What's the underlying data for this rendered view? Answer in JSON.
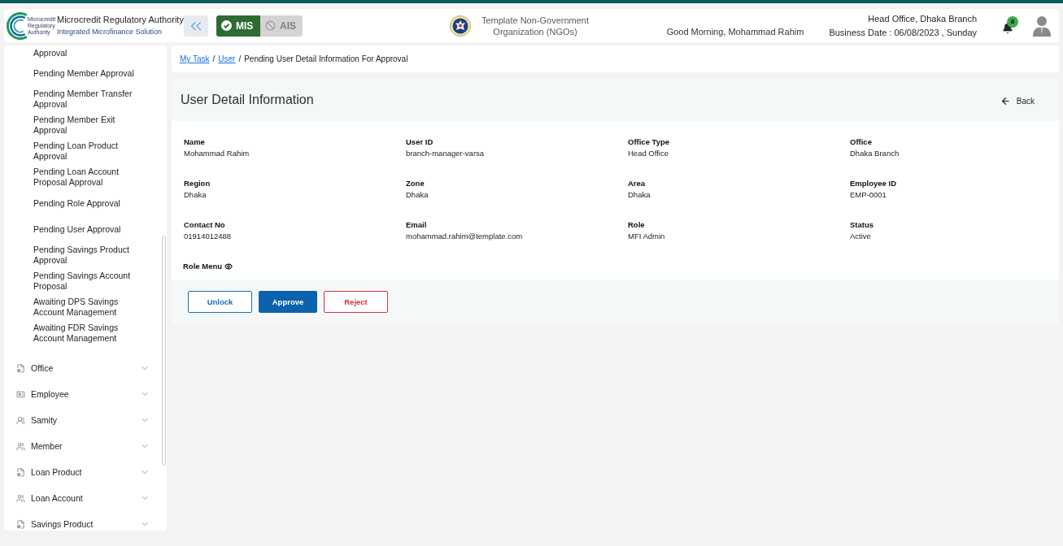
{
  "header": {
    "logo_text": "Microcredit Regulatory Authority",
    "title": "Microcredit Regulatory Authority",
    "subtitle": "Integrated Microfinance Solution",
    "modules": [
      {
        "label": "MIS",
        "selected": true
      },
      {
        "label": "AIS",
        "selected": false
      }
    ],
    "organization": "Template Non-Government Organization (NGOs)",
    "greeting": "Good Morning, Mohammad Rahim",
    "office": "Head Office, Dhaka Branch",
    "business_date": "Business Date : 06/08/2023 , Sunday",
    "notification_count": "8"
  },
  "sidebar": {
    "task_items": [
      "Approval",
      "Pending Member Approval",
      "Pending Member Transfer Approval",
      "Pending Member Exit Approval",
      "Pending Loan Product Approval",
      "Pending Loan Account Proposal Approval",
      "Pending Role Approval",
      "Pending User Approval",
      "Pending Savings Product Approval",
      "Pending Savings Account Proposal",
      "Awaiting DPS Savings Account Management",
      "Awaiting FDR Savings Account Management"
    ],
    "groups": [
      {
        "label": "Office",
        "kind": "document",
        "expanded": false
      },
      {
        "label": "Employee",
        "kind": "idcard",
        "expanded": false
      },
      {
        "label": "Samity",
        "kind": "team",
        "expanded": false
      },
      {
        "label": "Member",
        "kind": "people",
        "expanded": false
      },
      {
        "label": "Loan Product",
        "kind": "document",
        "expanded": false
      },
      {
        "label": "Loan Account",
        "kind": "people",
        "expanded": false
      },
      {
        "label": "Savings Product",
        "kind": "document",
        "expanded": false
      }
    ]
  },
  "breadcrumb": [
    {
      "kind": "link",
      "label": "My Task"
    },
    {
      "kind": "separator",
      "label": "/"
    },
    {
      "kind": "link",
      "label": "User"
    },
    {
      "kind": "separator",
      "label": "/"
    },
    {
      "kind": "current",
      "label": "Pending User Detail Information For Approval"
    }
  ],
  "detail": {
    "title": "User Detail Information",
    "back": "Back",
    "fields": [
      {
        "label": "Name",
        "value": "Mohammad Rahim"
      },
      {
        "label": "User ID",
        "value": "branch-manager-varsa"
      },
      {
        "label": "Office Type",
        "value": "Head Office"
      },
      {
        "label": "Office",
        "value": "Dhaka Branch"
      },
      {
        "label": "Region",
        "value": "Dhaka"
      },
      {
        "label": "Zone",
        "value": "Dhaka"
      },
      {
        "label": "Area",
        "value": "Dhaka"
      },
      {
        "label": "Employee ID",
        "value": "EMP-0001"
      },
      {
        "label": "Contact No",
        "value": "01914012488"
      },
      {
        "label": "Email",
        "value": "mohammad.rahim@template.com"
      },
      {
        "label": "Role",
        "value": "MFI Admin"
      },
      {
        "label": "Status",
        "value": "Active"
      }
    ],
    "role_menu": "Role Menu",
    "actions": [
      {
        "label": "Unlock",
        "kind": "outline"
      },
      {
        "label": "Approve",
        "kind": "primary"
      },
      {
        "label": "Reject",
        "kind": "danger"
      }
    ]
  }
}
